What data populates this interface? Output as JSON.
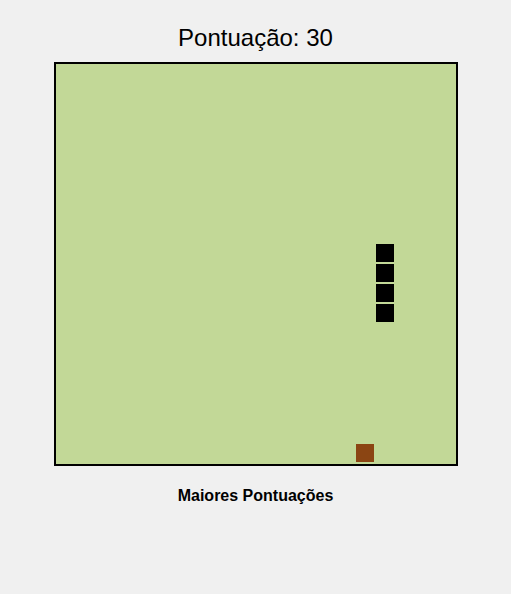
{
  "score": {
    "label": "Pontuação: 30"
  },
  "board": {
    "columns": 20,
    "rows": 20,
    "snake": [
      {
        "x": 16,
        "y": 9
      },
      {
        "x": 16,
        "y": 10
      },
      {
        "x": 16,
        "y": 11
      },
      {
        "x": 16,
        "y": 12
      }
    ],
    "food": {
      "x": 15,
      "y": 19
    }
  },
  "high_scores": {
    "title": "Maiores Pontuações",
    "entries": []
  }
}
